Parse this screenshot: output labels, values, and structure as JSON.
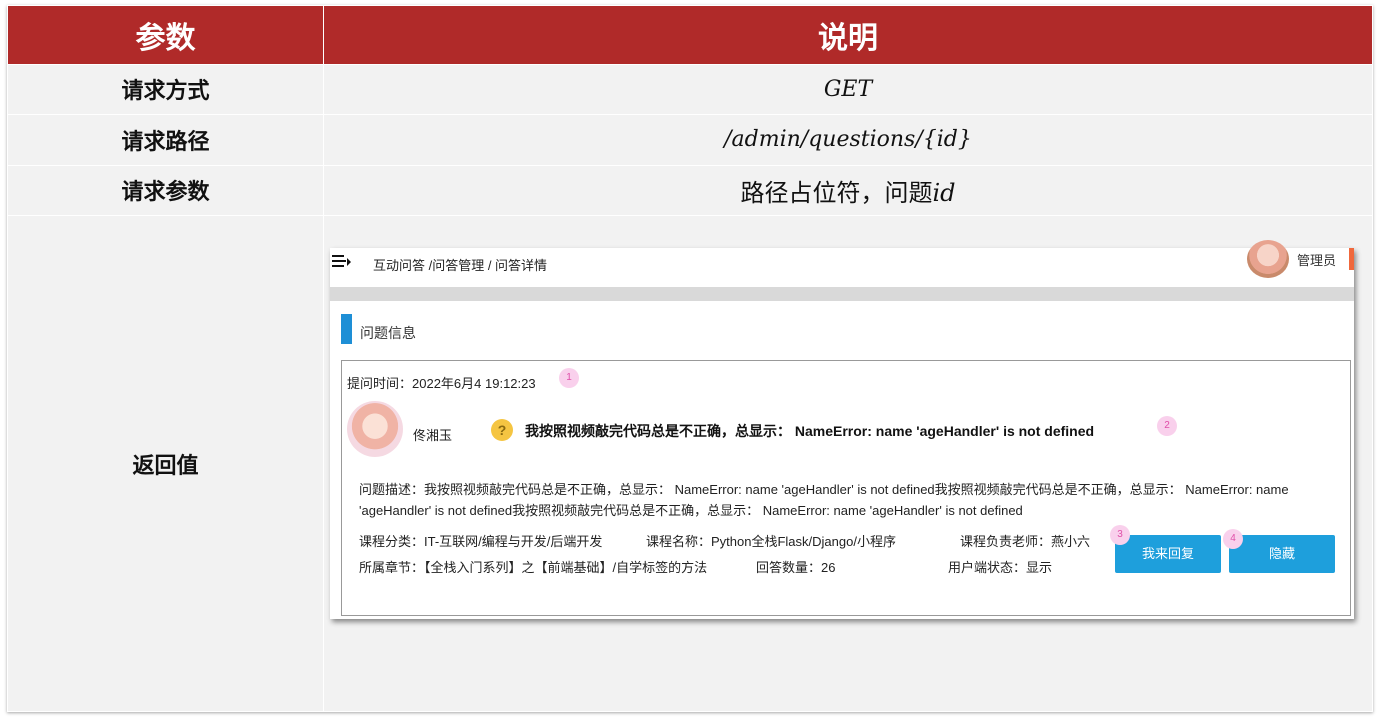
{
  "table": {
    "header_param": "参数",
    "header_desc": "说明",
    "rows": [
      {
        "label": "请求方式",
        "value": "GET"
      },
      {
        "label": "请求路径",
        "value": "/admin/questions/{id}"
      },
      {
        "label": "请求参数",
        "value_prefix": "路径占位符，问题",
        "value_suffix": "id"
      },
      {
        "label": "返回值"
      }
    ]
  },
  "screenshot": {
    "breadcrumb": "互动问答 /问答管理 / 问答详情",
    "admin_name": "管理员",
    "section_title": "问题信息",
    "ask_time": "提问时间：2022年6月4 19:12:23",
    "user_name": "佟湘玉",
    "question_title": "我按照视频敲完代码总是不正确，总显示： NameError: name 'ageHandler' is not defined",
    "question_desc": "问题描述：我按照视频敲完代码总是不正确，总显示： NameError: name 'ageHandler' is not defined我按照视频敲完代码总是不正确，总显示： NameError: name 'ageHandler' is not defined我按照视频敲完代码总是不正确，总显示： NameError: name 'ageHandler' is not defined",
    "course_category": "课程分类：IT-互联网/编程与开发/后端开发",
    "course_name": "课程名称：Python全栈Flask/Django/小程序",
    "teacher": "课程负责老师：燕小六",
    "chapter": "所属章节：【全栈入门系列】之【前端基础】/自学标签的方法",
    "answer_count": "回答数量：26",
    "user_status": "用户端状态：显示",
    "reply_button": "我来回复",
    "hide_button": "隐藏",
    "markers": [
      "1",
      "2",
      "3",
      "4"
    ]
  },
  "colors": {
    "header_bg": "#b02a29",
    "cell_bg": "#f2f2f2",
    "button": "#1e9fdc",
    "accent_bar": "#1e8fd6"
  }
}
